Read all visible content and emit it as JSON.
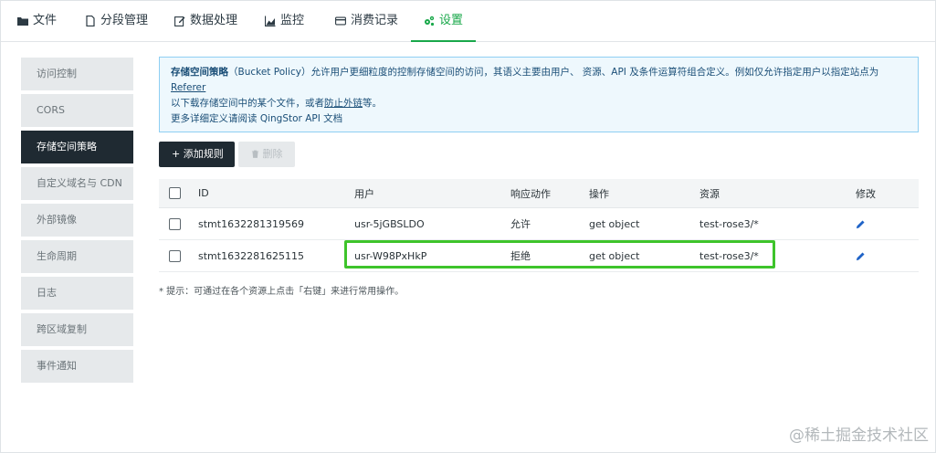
{
  "tabs": [
    {
      "label": "文件",
      "icon": "folder-icon"
    },
    {
      "label": "分段管理",
      "icon": "file-icon"
    },
    {
      "label": "数据处理",
      "icon": "edit-icon"
    },
    {
      "label": "监控",
      "icon": "area-chart-icon"
    },
    {
      "label": "消费记录",
      "icon": "card-icon"
    },
    {
      "label": "设置",
      "icon": "gears-icon",
      "active": true
    }
  ],
  "sidebar": {
    "items": [
      {
        "label": "访问控制"
      },
      {
        "label": "CORS"
      },
      {
        "label": "存储空间策略",
        "active": true
      },
      {
        "label": "自定义域名与 CDN"
      },
      {
        "label": "外部镜像"
      },
      {
        "label": "生命周期"
      },
      {
        "label": "日志"
      },
      {
        "label": "跨区域复制"
      },
      {
        "label": "事件通知"
      }
    ]
  },
  "info": {
    "title": "存储空间策略",
    "text1": "（Bucket Policy）允许用户更细粒度的控制存储空间的访问，其语义主要由用户、 资源、API 及条件运算符组合定义。例如仅允许指定用户以指定站点为",
    "link_referer": "Referer",
    "text2": "以下载存储空间中的某个文件，或者",
    "link_hotlink": "防止外链",
    "text3": "等。",
    "more": "更多详细定义请阅读 QingStor API 文档"
  },
  "toolbar": {
    "add_label": "+ 添加规则",
    "delete_label": "删除"
  },
  "table": {
    "headers": {
      "id": "ID",
      "user": "用户",
      "action": "响应动作",
      "operation": "操作",
      "resource": "资源",
      "edit": "修改"
    },
    "rows": [
      {
        "id": "stmt1632281319569",
        "user": "usr-5jGBSLDO",
        "action": "允许",
        "operation": "get object",
        "resource": "test-rose3/*"
      },
      {
        "id": "stmt1632281625115",
        "user": "usr-W98PxHkP",
        "action": "拒绝",
        "operation": "get object",
        "resource": "test-rose3/*"
      }
    ]
  },
  "hint": "* 提示：可通过在各个资源上点击「右键」来进行常用操作。",
  "watermark": "@稀土掘金技术社区",
  "colors": {
    "accent": "#19a84a",
    "dark": "#1f2a32",
    "highlight": "#3ec42b",
    "info_border": "#8fcff3"
  }
}
